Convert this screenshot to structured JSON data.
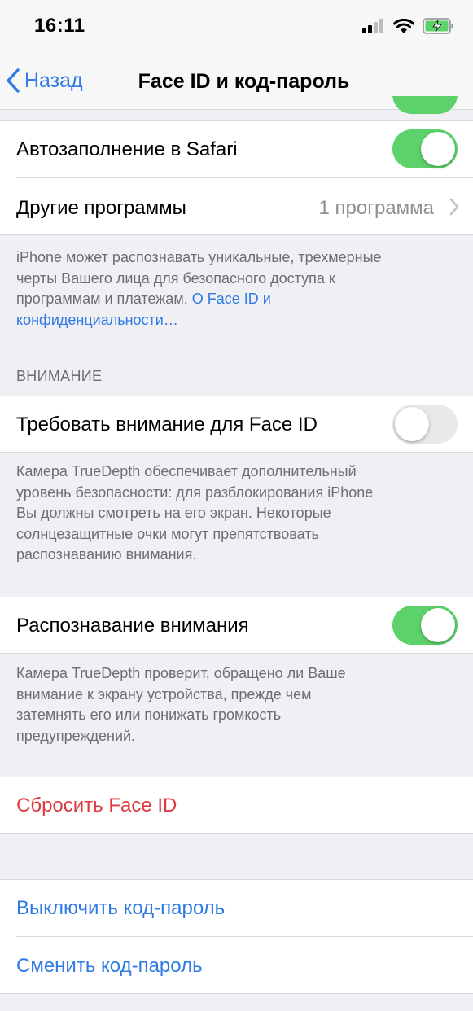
{
  "status_bar": {
    "time": "16:11"
  },
  "nav": {
    "back_label": "Назад",
    "title": "Face ID и код-пароль"
  },
  "rows": {
    "safari_autofill": {
      "label": "Автозаполнение в Safari",
      "toggle_on": true
    },
    "other_apps": {
      "label": "Другие программы",
      "value": "1 программа"
    },
    "require_attention": {
      "label": "Требовать внимание для Face ID",
      "toggle_on": false
    },
    "attention_aware": {
      "label": "Распознавание внимания",
      "toggle_on": true
    },
    "reset_face_id": {
      "label": "Сбросить Face ID"
    },
    "turn_off_passcode": {
      "label": "Выключить код-пароль"
    },
    "change_passcode": {
      "label": "Сменить код-пароль"
    }
  },
  "footers": {
    "face_id_info": {
      "lines": [
        "iPhone может распознавать уникальные, трехмерные",
        "черты Вашего лица для безопасного доступа к",
        "программам и платежам. "
      ],
      "link_line1": "О Face ID и",
      "link_line2": "конфиденциальности…"
    },
    "require_attention_info": {
      "lines": [
        "Камера TrueDepth обеспечивает дополнительный",
        "уровень безопасности: для разблокирования iPhone",
        "Вы должны смотреть на его экран. Некоторые",
        "солнцезащитные очки могут препятствовать",
        "распознаванию внимания."
      ]
    },
    "attention_aware_info": {
      "lines": [
        "Камера TrueDepth проверит, обращено ли Ваше",
        "внимание к экрану устройства, прежде чем",
        "затемнять его или понижать громкость",
        "предупреждений."
      ]
    }
  },
  "section_headers": {
    "attention": "ВНИМАНИЕ"
  },
  "colors": {
    "accent_blue": "#2f7ae5",
    "toggle_green": "#5dd26a",
    "destructive_red": "#e0383e"
  }
}
